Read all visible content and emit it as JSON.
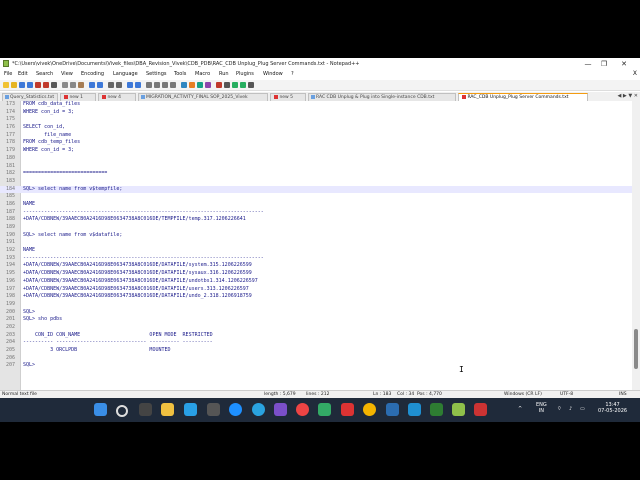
{
  "window": {
    "title": "*C:\\Users\\vivek\\OneDrive\\Documents\\Vivek_files\\DBA_Revision_Vivek\\CDB_PDB\\RAC_CDB Unplug_Plug Server Commands.txt - Notepad++",
    "minimize": "—",
    "maximize": "❐",
    "close": "✕",
    "doc_close": "X"
  },
  "menu": [
    "File",
    "Edit",
    "Search",
    "View",
    "Encoding",
    "Language",
    "Settings",
    "Tools",
    "Macro",
    "Run",
    "Plugins",
    "Window",
    "?"
  ],
  "tabs": [
    {
      "label": "Query_Statistics.txt",
      "active": false
    },
    {
      "label": "new 1",
      "active": false
    },
    {
      "label": "new 4",
      "active": false
    },
    {
      "label": "MIGRATION_ACTIVITY_FINAL SOP_2025_Vivek",
      "active": false
    },
    {
      "label": "new 5",
      "active": false
    },
    {
      "label": "RAC CDB Unplug & Plug into Single-instance CDB.txt",
      "active": false
    },
    {
      "label": "RAC_CDB Unplug_Plug Server Commands.txt",
      "active": true
    }
  ],
  "tab_arrows": "◀ ▶ ▼ ✕",
  "lines": [
    {
      "n": "173",
      "t": "FROM cdb_data_files"
    },
    {
      "n": "174",
      "t": "WHERE con_id = 3;"
    },
    {
      "n": "175",
      "t": ""
    },
    {
      "n": "176",
      "t": "SELECT con_id,"
    },
    {
      "n": "177",
      "t": "       file_name"
    },
    {
      "n": "178",
      "t": "FROM cdb_temp_files"
    },
    {
      "n": "179",
      "t": "WHERE con_id = 3;"
    },
    {
      "n": "180",
      "t": ""
    },
    {
      "n": "181",
      "t": ""
    },
    {
      "n": "182",
      "t": "============================"
    },
    {
      "n": "183",
      "t": ""
    },
    {
      "n": "184",
      "t": "SQL> select name from v$tempfile;",
      "current": true
    },
    {
      "n": "185",
      "t": ""
    },
    {
      "n": "186",
      "t": "NAME"
    },
    {
      "n": "187",
      "t": "--------------------------------------------------------------------------------"
    },
    {
      "n": "188",
      "t": "+DATA/CDBNEW/39AAECB0A2416D98E0634738A8C016DE/TEMPFILE/temp.317.1206226641"
    },
    {
      "n": "189",
      "t": ""
    },
    {
      "n": "190",
      "t": "SQL> select name from v$datafile;"
    },
    {
      "n": "191",
      "t": ""
    },
    {
      "n": "192",
      "t": "NAME"
    },
    {
      "n": "193",
      "t": "--------------------------------------------------------------------------------"
    },
    {
      "n": "194",
      "t": "+DATA/CDBNEW/39AAECB0A2416D98E0634738A8C016DE/DATAFILE/system.315.1206226599"
    },
    {
      "n": "195",
      "t": "+DATA/CDBNEW/39AAECB0A2416D98E0634738A8C016DE/DATAFILE/sysaux.316.1206226599"
    },
    {
      "n": "196",
      "t": "+DATA/CDBNEW/39AAECB0A2416D98E0634738A8C016DE/DATAFILE/undotbs1.314.1206226597"
    },
    {
      "n": "197",
      "t": "+DATA/CDBNEW/39AAECB0A2416D98E0634738A8C016DE/DATAFILE/users.313.1206226597"
    },
    {
      "n": "198",
      "t": "+DATA/CDBNEW/39AAECB0A2416D98E0634738A8C016DE/DATAFILE/undo_2.318.1206918759"
    },
    {
      "n": "199",
      "t": ""
    },
    {
      "n": "200",
      "t": "SQL>"
    },
    {
      "n": "201",
      "t": "SQL> sho pdbs"
    },
    {
      "n": "202",
      "t": ""
    },
    {
      "n": "203",
      "t": "    CON_ID CON_NAME                       OPEN MODE  RESTRICTED"
    },
    {
      "n": "204",
      "t": "---------- ------------------------------ ---------- ----------"
    },
    {
      "n": "205",
      "t": "         3 ORCLPDB                        MOUNTED"
    },
    {
      "n": "206",
      "t": ""
    },
    {
      "n": "207",
      "t": "SQL>"
    }
  ],
  "status": {
    "file_type": "Normal text file",
    "length": "length : 5,679",
    "lines": "lines : 212",
    "ln": "Ln : 183",
    "col": "Col : 34",
    "pos": "Pos : 4,770",
    "eol": "Windows (CR LF)",
    "encoding": "UTF-8",
    "mode": "INS"
  },
  "tray": {
    "lang_top": "ENG",
    "lang_bottom": "IN",
    "time": "13:47",
    "date": "07-05-2026",
    "chevron": "^"
  },
  "colors": {
    "accent": "#f39c12",
    "code_text": "#1a1a8a",
    "taskbar": "#1f2a3a"
  }
}
